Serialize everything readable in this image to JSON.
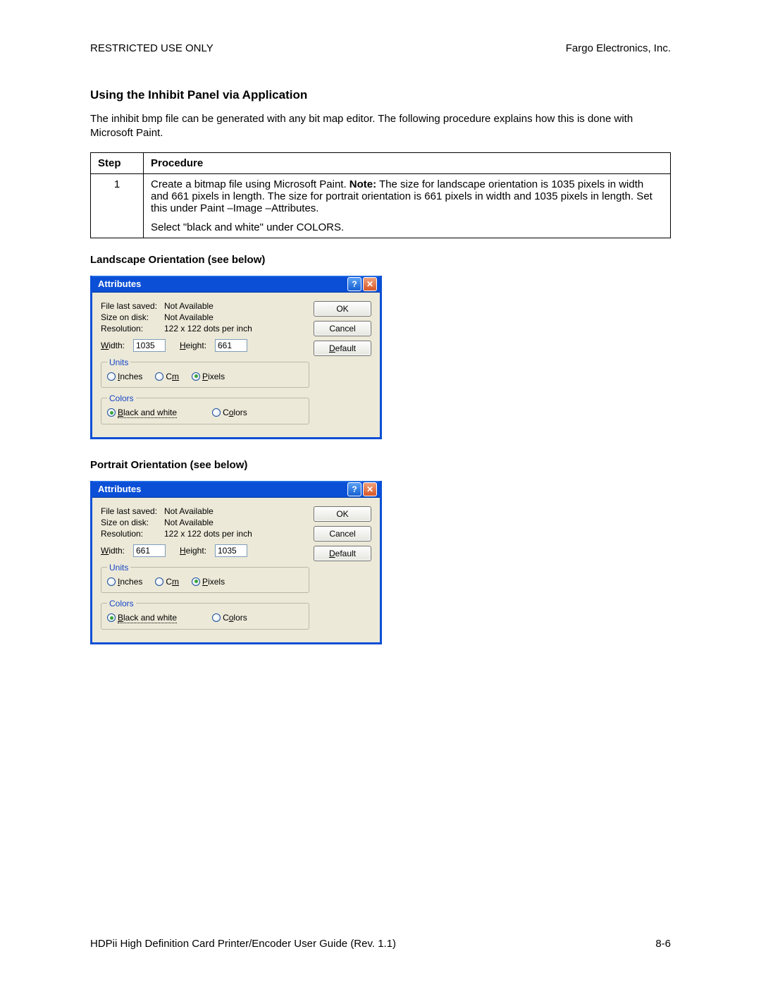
{
  "header": {
    "left": "RESTRICTED USE ONLY",
    "right": "Fargo Electronics, Inc."
  },
  "title": "Using the Inhibit Panel via Application",
  "intro": "The inhibit bmp file can be generated with any bit map editor.  The following procedure explains how this is done with Microsoft Paint.",
  "table": {
    "headers": {
      "step": "Step",
      "procedure": "Procedure"
    },
    "row": {
      "num": "1",
      "para1_a": "Create a bitmap file using Microsoft Paint. ",
      "para1_note": "Note:",
      "para1_b": "  The size for landscape orientation is 1035 pixels in width and 661 pixels in length. The size for portrait orientation is 661 pixels in width and 1035 pixels in length. Set this under Paint –Image –Attributes.",
      "para2": "Select \"black and white\" under COLORS."
    }
  },
  "landscape_label": "Landscape Orientation (see below)",
  "portrait_label": "Portrait Orientation (see below)",
  "dlg": {
    "title": "Attributes",
    "labels": {
      "file_last_saved": "File last saved:",
      "size_on_disk": "Size on disk:",
      "resolution": "Resolution:",
      "not_available": "Not Available",
      "resolution_val": "122 x 122 dots per inch",
      "width_u": "W",
      "width_rest": "idth:",
      "height_u": "H",
      "height_rest": "eight:",
      "units": "Units",
      "inches_u": "I",
      "inches_rest": "nches",
      "cm_pre": "C",
      "cm_u": "m",
      "pixels_u": "P",
      "pixels_rest": "ixels",
      "colors": "Colors",
      "bw_u": "B",
      "bw_rest": "lack and white",
      "colors_opt_pre": "C",
      "colors_opt_u": "o",
      "colors_opt_rest": "lors"
    },
    "buttons": {
      "ok": "OK",
      "cancel": "Cancel",
      "default_u": "D",
      "default_rest": "efault"
    },
    "landscape": {
      "width": "1035",
      "height": "661"
    },
    "portrait": {
      "width": "661",
      "height": "1035"
    }
  },
  "footer": {
    "left": "HDPii High Definition Card Printer/Encoder User Guide (Rev. 1.1)",
    "right": "8-6"
  }
}
